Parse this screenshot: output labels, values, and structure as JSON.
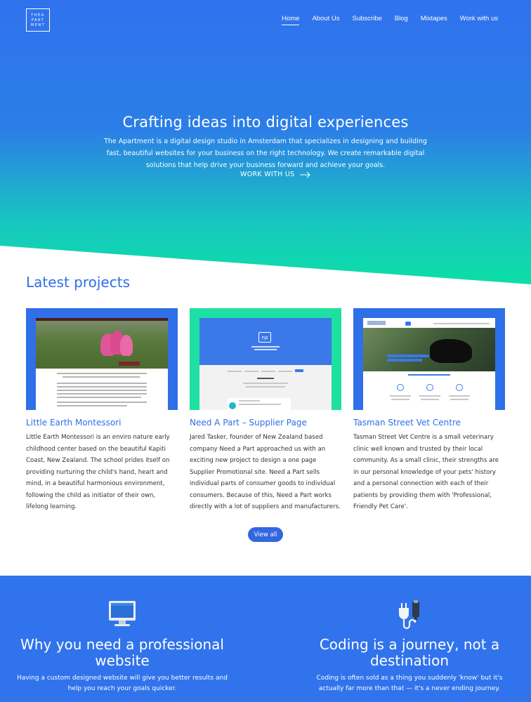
{
  "brand": {
    "logo_lines": [
      "THEA",
      "PART",
      "MENT"
    ]
  },
  "nav": {
    "items": [
      "Home",
      "About Us",
      "Subscribe",
      "Blog",
      "Mixtapes",
      "Work with us"
    ],
    "active": "Home"
  },
  "hero": {
    "title": "Crafting ideas into digital experiences",
    "description": "The Apartment is a digital design studio in Amsterdam that specializes in designing and building fast, beautiful websites for your business on the right technology. We create remarkable digital solutions that help drive your business forward and achieve your goals.",
    "cta_label": "WORK WITH US",
    "cta_icon": "arrow-right-icon"
  },
  "projects": {
    "heading": "Latest projects",
    "items": [
      {
        "title": "Little Earth Montessori",
        "text": "Little Earth Montessori is an enviro nature early childhood center based on the beautiful Kapiti Coast, New Zealand. The school prides itself on providing nurturing the child's hand, heart and mind, in a beautiful harmonious environment, following the child as initiator of their own, lifelong learning."
      },
      {
        "title": "Need A Part – Supplier Page",
        "text": "Jared Tasker, founder of New Zealand based company Need a Part approached us with an exciting new project to design a one page Supplier Promotional site. Need a Part sells individual parts of consumer goods to individual consumers. Because of this, Need a Part works directly with a lot of suppliers and manufacturers.",
        "thumb_logo": "np"
      },
      {
        "title": "Tasman Street Vet Centre",
        "text": "Tasman Street Vet Centre is a small veterinary clinic well known and trusted by their local community. As a small clinic, their strengths are in our personal knowledge of your pets' history and a personal connection with each of their patients by providing them with 'Professional, Friendly Pet Care'."
      }
    ],
    "view_all_label": "View all"
  },
  "features": [
    {
      "icon": "monitor-icon",
      "title": "Why you need a professional website",
      "text": "Having a custom designed website will give you better results and help you reach your goals quicker."
    },
    {
      "icon": "plug-icon",
      "title": "Coding is a journey, not a destination",
      "text": "Coding is often sold as a thing you suddenly 'know' but it's actually far more than that — it's a never ending journey."
    }
  ],
  "colors": {
    "accent": "#2f6fe7",
    "gradient_top": "#3072ee",
    "gradient_bottom": "#0be0a4",
    "features_bg": "#3173ec",
    "button_bg": "#3367e0"
  }
}
